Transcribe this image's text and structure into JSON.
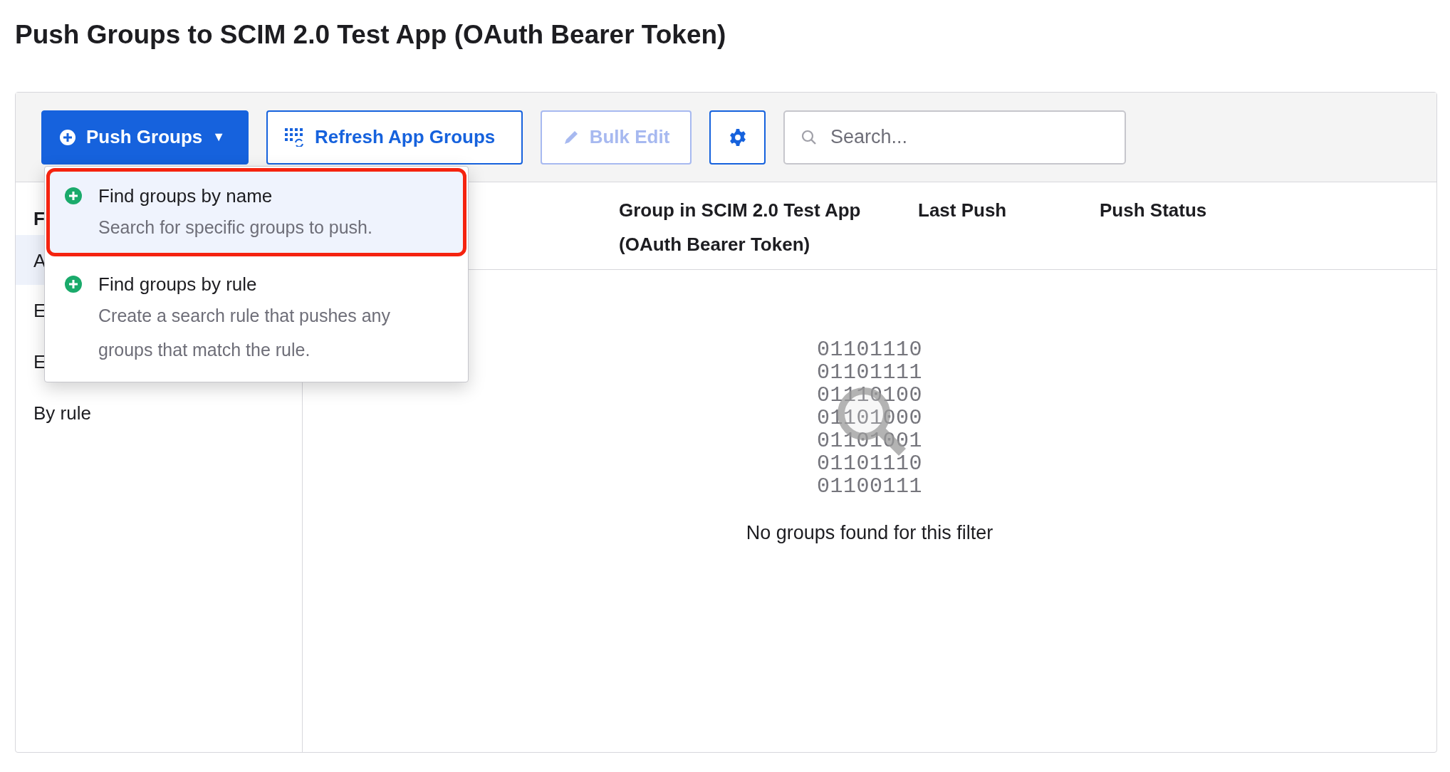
{
  "title": "Push Groups to SCIM 2.0 Test App (OAuth Bearer Token)",
  "toolbar": {
    "buttons": [
      {
        "kind": "menu",
        "label": "Push Groups",
        "caret": "▼",
        "disabled": false
      },
      {
        "kind": "refresh",
        "label": "Refresh App Groups",
        "disabled": false
      },
      {
        "kind": "edit",
        "label": "Bulk Edit",
        "disabled": true
      },
      {
        "kind": "settings",
        "disabled": false
      }
    ],
    "search": {
      "placeholder": "Search..."
    }
  },
  "sidebar": {
    "heading": "F",
    "items": [
      {
        "label": "A",
        "selected": true
      },
      {
        "label": "E",
        "selected": false
      },
      {
        "label": "E",
        "selected": false
      },
      {
        "label": "By rule",
        "selected": false
      }
    ]
  },
  "table": {
    "columns": [
      "Group in SCIM 2.0 Test App (OAuth Bearer Token)",
      "Last Push",
      "Push Status"
    ],
    "empty_state": {
      "art_lines": [
        "01101110",
        "01101111",
        "01110100",
        "01101000",
        "01101001",
        "01101110",
        "01100111"
      ],
      "message": "No groups found for this filter"
    }
  },
  "dropdown": {
    "items": [
      {
        "title": "Find groups by name",
        "description": "Search for specific groups to push.",
        "highlighted": true
      },
      {
        "title": "Find groups by rule",
        "description": "Create a search rule that pushes any groups that match the rule.",
        "highlighted": false
      }
    ]
  }
}
